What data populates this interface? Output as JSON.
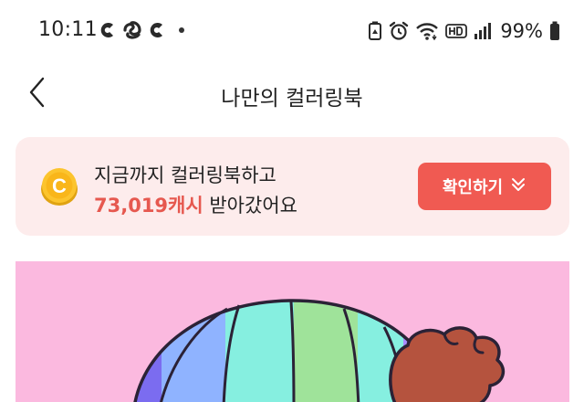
{
  "status_bar": {
    "time": "10:11",
    "battery": "99%",
    "notification_icons": [
      "app-c-icon",
      "app-swirl-icon",
      "app-c-icon"
    ],
    "system_icons": [
      "battery-saver-icon",
      "alarm-icon",
      "wifi-icon",
      "hd-voice-icon",
      "signal-icon",
      "battery-icon"
    ]
  },
  "header": {
    "title": "나만의 컬러링북"
  },
  "banner": {
    "line1": "지금까지 컬러링북하고",
    "amount": "73,019캐시",
    "line2_suffix": " 받아갔어요",
    "button_label": "확인하기",
    "coin_letter": "C",
    "accent": "#f05a52",
    "background": "#fdecec"
  },
  "preview": {
    "background": "#fbb9df",
    "stripe_colors": [
      "#7b6cf0",
      "#8fb3ff",
      "#86efe0",
      "#9fe39a",
      "#86efe0",
      "#a98cff"
    ],
    "hair_color": "#b5533e"
  }
}
